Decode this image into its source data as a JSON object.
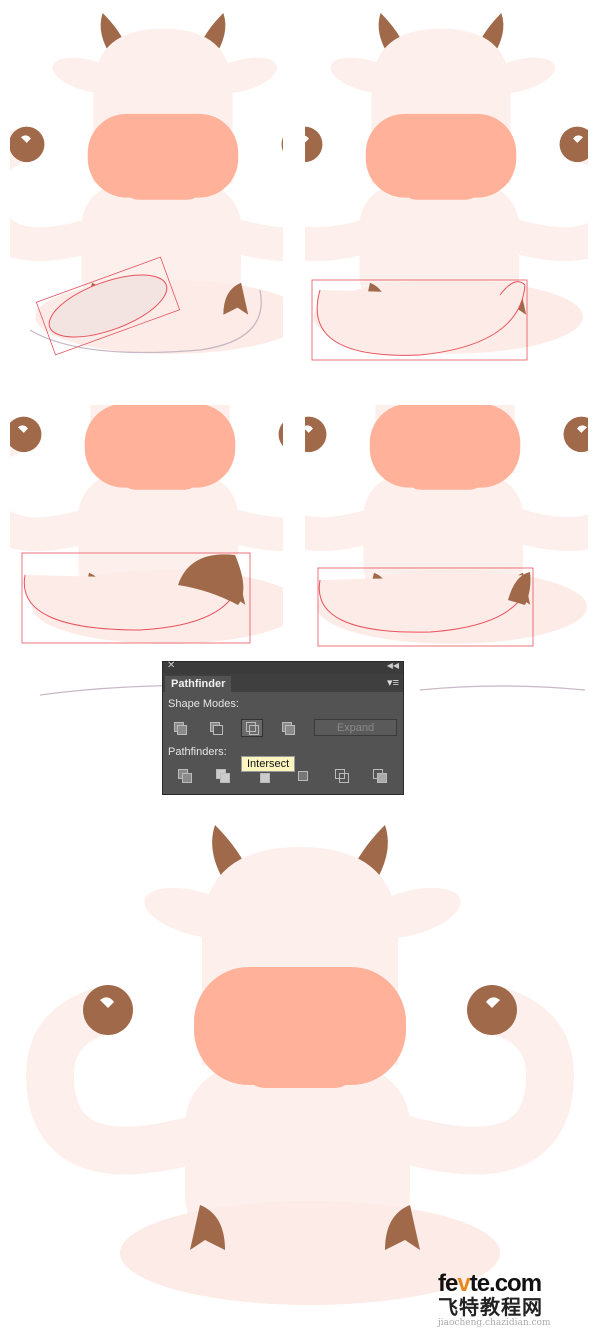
{
  "colors": {
    "body": "#fdf0ec",
    "nose": "#ffb299",
    "brown": "#a0694a",
    "sketch": "#c8b8c4",
    "selection": "#e8525e",
    "panel": "#535353"
  },
  "pathfinder": {
    "close_icon": "close-icon",
    "collapse_icon": "double-chevron-icon",
    "tab": "Pathfinder",
    "menu_icon": "panel-menu-icon",
    "shape_modes_label": "Shape Modes:",
    "shape_modes": [
      {
        "name": "unite",
        "icon": "unite-icon"
      },
      {
        "name": "minus-front",
        "icon": "minus-front-icon"
      },
      {
        "name": "intersect",
        "icon": "intersect-icon",
        "active": true
      },
      {
        "name": "exclude",
        "icon": "exclude-icon"
      }
    ],
    "expand": "Expand",
    "pathfinders_label": "Pathfinders:",
    "pathfinders": [
      {
        "icon": "divide-icon"
      },
      {
        "icon": "trim-icon"
      },
      {
        "icon": "merge-icon"
      },
      {
        "icon": "crop-icon"
      },
      {
        "icon": "outline-icon"
      },
      {
        "icon": "minus-back-icon"
      }
    ],
    "tooltip": "Intersect"
  },
  "watermark": {
    "brand": "fevte.com",
    "chinese": "飞特教程网",
    "url": "jiaocheng.chazidian.com"
  }
}
